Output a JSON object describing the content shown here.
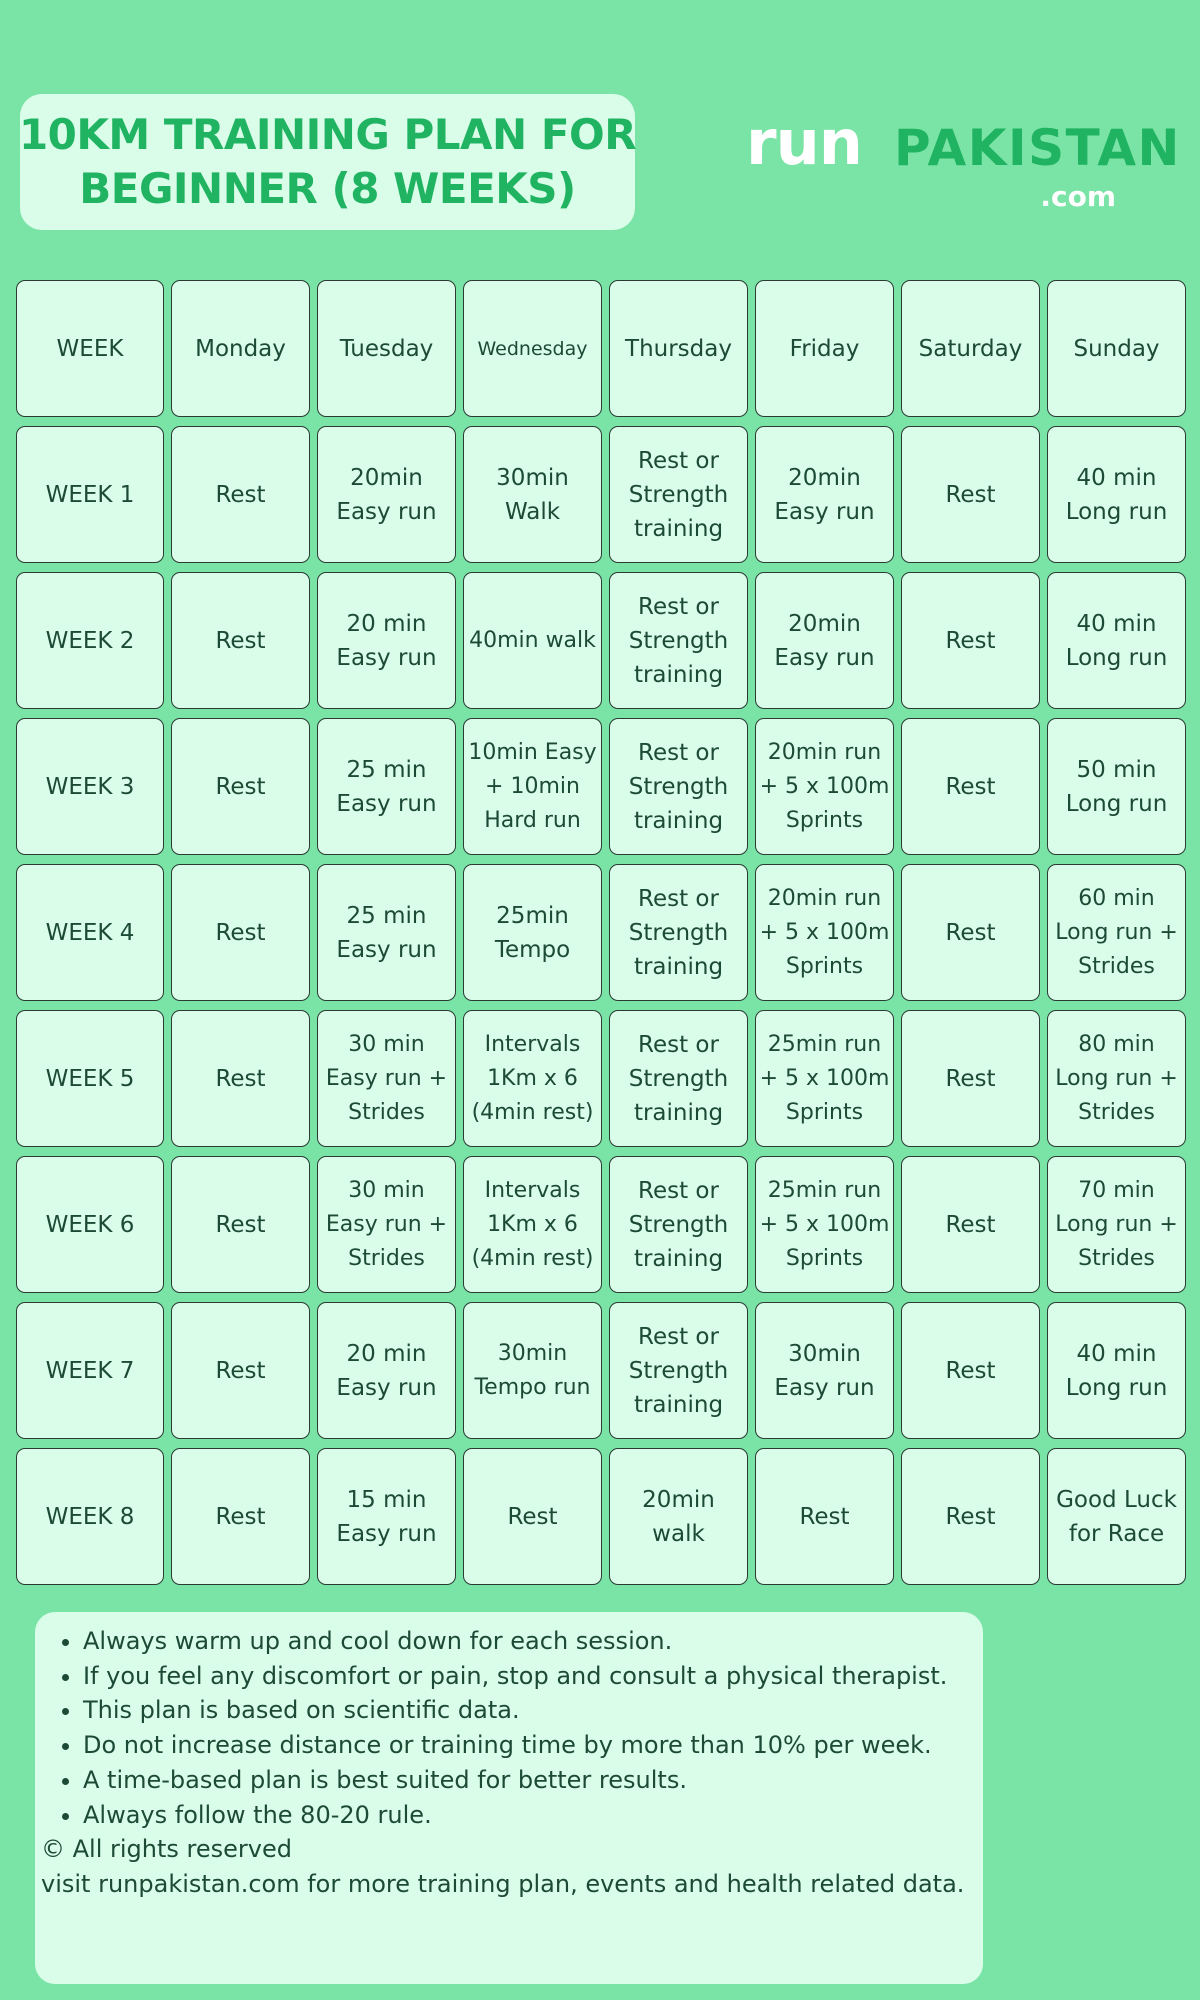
{
  "header": {
    "title_line1": "10KM TRAINING PLAN FOR",
    "title_line2": "BEGINNER (8 WEEKS)",
    "logo": {
      "run": "run",
      "pakistan": "PAKISTAN",
      "com": ".com"
    }
  },
  "table": {
    "columns": [
      "WEEK",
      "Monday",
      "Tuesday",
      "Wednesday",
      "Thursday",
      "Friday",
      "Saturday",
      "Sunday"
    ],
    "rows": [
      [
        "WEEK 1",
        "Rest",
        "20min\nEasy run",
        "30min\nWalk",
        "Rest or\nStrength\ntraining",
        "20min\nEasy run",
        "Rest",
        "40 min\nLong run"
      ],
      [
        "WEEK 2",
        "Rest",
        "20 min\nEasy run",
        "40min walk",
        "Rest or\nStrength\ntraining",
        "20min\nEasy run",
        "Rest",
        "40 min\nLong run"
      ],
      [
        "WEEK 3",
        "Rest",
        "25 min\nEasy run",
        "10min Easy\n+ 10min\nHard run",
        "Rest or\nStrength\ntraining",
        "20min run\n+ 5 x 100m\nSprints",
        "Rest",
        "50 min\nLong run"
      ],
      [
        "WEEK 4",
        "Rest",
        "25 min\nEasy run",
        "25min\nTempo",
        "Rest or\nStrength\ntraining",
        "20min run\n+ 5 x 100m\nSprints",
        "Rest",
        "60 min\nLong run +\nStrides"
      ],
      [
        "WEEK 5",
        "Rest",
        "30 min\nEasy run +\nStrides",
        "Intervals\n1Km x 6\n(4min rest)",
        "Rest or\nStrength\ntraining",
        "25min run\n+ 5 x 100m\nSprints",
        "Rest",
        "80 min\nLong run +\nStrides"
      ],
      [
        "WEEK 6",
        "Rest",
        "30 min\nEasy run +\nStrides",
        "Intervals\n1Km x 6\n(4min rest)",
        "Rest or\nStrength\ntraining",
        "25min run\n+ 5 x 100m\nSprints",
        "Rest",
        "70 min\nLong run +\nStrides"
      ],
      [
        "WEEK 7",
        "Rest",
        "20 min\nEasy run",
        "30min\nTempo run",
        "Rest or\nStrength\ntraining",
        "30min\nEasy run",
        "Rest",
        "40 min\nLong run"
      ],
      [
        "WEEK 8",
        "Rest",
        "15 min\nEasy run",
        "Rest",
        "20min\nwalk",
        "Rest",
        "Rest",
        "Good Luck\nfor Race"
      ]
    ]
  },
  "notes": {
    "bullets": [
      "Always warm up and cool down for each session.",
      "If you feel any discomfort or pain, stop and consult a physical therapist.",
      "This plan is based on scientific data.",
      "Do not increase distance or training time by more than 10% per week.",
      "A time-based plan is best suited for better results.",
      "Always follow the 80-20 rule."
    ],
    "copyright": "© All rights reserved",
    "visit": "visit runpakistan.com for more training plan, events and health related data."
  }
}
